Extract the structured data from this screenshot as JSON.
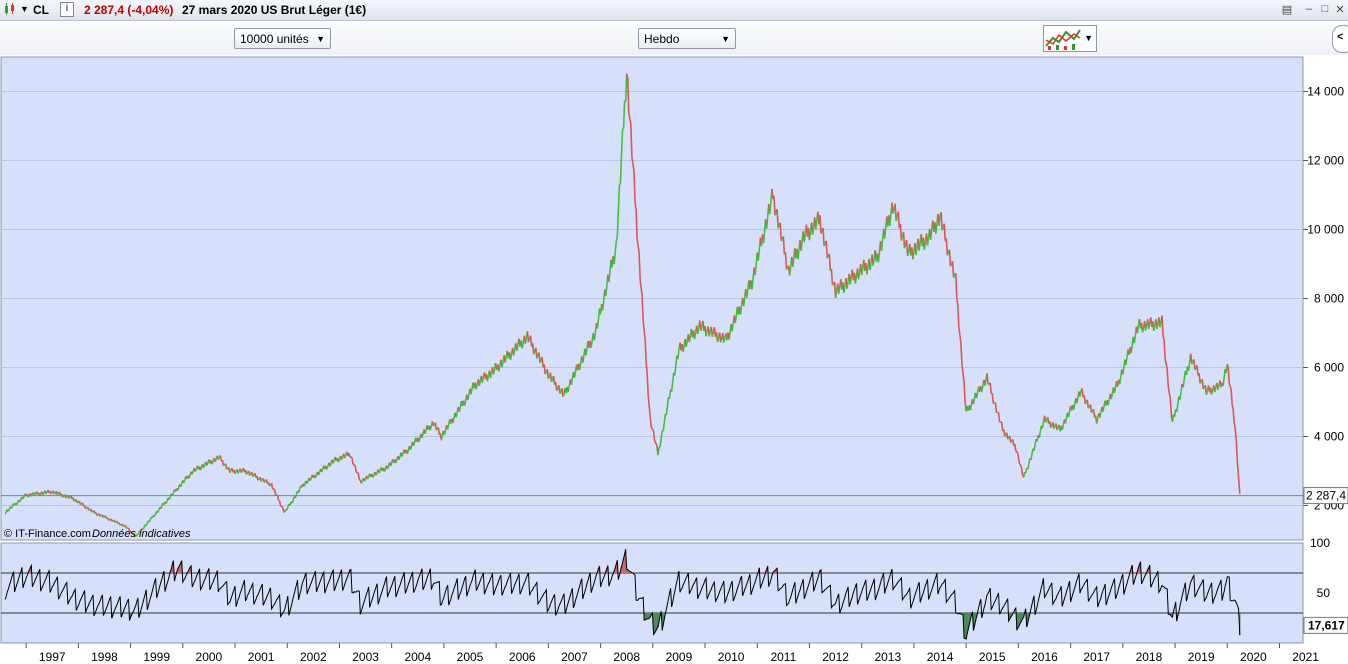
{
  "header": {
    "symbol": "CL",
    "info_icon": "i",
    "quote": "2 287,4 (-4,04%)",
    "date_name": "27 mars 2020 US Brut Léger (1€)"
  },
  "toolbar": {
    "units_select": "10000 unités",
    "period_select": "Hebdo"
  },
  "icons": [
    "candlestick-icon",
    "dropdown-arrow-icon",
    "info-icon",
    "chart-type-icon",
    "minimize-icon",
    "restore-icon",
    "close-icon",
    "nav-arrow-icon"
  ],
  "colors": {
    "background": "#d7e0fb",
    "up": "#3ec23e",
    "down": "#e05454",
    "price_line": "#3cb43c",
    "rsi_line": "#000000",
    "header_quote": "#c00000"
  },
  "credits": {
    "source": "© IT-Finance.com",
    "note": "Données indicatives"
  },
  "chart_data": [
    {
      "type": "line",
      "title": "US Brut Léger (1€)",
      "frequency": "Hebdo",
      "x_ticks": [
        "1997",
        "1998",
        "1999",
        "2000",
        "2001",
        "2002",
        "2003",
        "2004",
        "2005",
        "2006",
        "2007",
        "2008",
        "2009",
        "2010",
        "2011",
        "2012",
        "2013",
        "2014",
        "2015",
        "2016",
        "2017",
        "2018",
        "2019",
        "2020",
        "2021"
      ],
      "y_ticks": [
        "2 000",
        "4 000",
        "6 000",
        "8 000",
        "10 000",
        "12 000",
        "14 000"
      ],
      "ylim": [
        1000,
        15000
      ],
      "grid": true,
      "current_value_label": "2 287,4",
      "current_value": 2287.4,
      "series": [
        {
          "x": [
            1996.6,
            1997.0,
            1997.5,
            1997.9,
            1998.3,
            1998.9,
            1999.1,
            1999.5,
            1999.9,
            2000.2,
            2000.7,
            2000.9,
            2001.2,
            2001.7,
            2001.95,
            2002.3,
            2002.9,
            2003.2,
            2003.4,
            2003.9,
            2004.3,
            2004.8,
            2004.95,
            2005.6,
            2005.95,
            2006.6,
            2007.0,
            2007.3,
            2007.9,
            2008.3,
            2008.5,
            2008.7,
            2008.95,
            2009.1,
            2009.5,
            2009.9,
            2010.4,
            2010.9,
            2011.3,
            2011.6,
            2011.9,
            2012.2,
            2012.5,
            2012.9,
            2013.3,
            2013.6,
            2013.9,
            2014.3,
            2014.5,
            2014.8,
            2015.0,
            2015.4,
            2015.7,
            2015.95,
            2016.1,
            2016.5,
            2016.8,
            2017.2,
            2017.5,
            2017.9,
            2018.3,
            2018.75,
            2018.95,
            2019.3,
            2019.6,
            2019.9,
            2020.0,
            2020.15,
            2020.24
          ],
          "y": [
            1800,
            2300,
            2400,
            2200,
            1800,
            1400,
            1100,
            1800,
            2500,
            3000,
            3400,
            3000,
            3000,
            2600,
            1800,
            2600,
            3300,
            3500,
            2700,
            3100,
            3600,
            4400,
            4000,
            5500,
            5900,
            6900,
            5800,
            5200,
            7000,
            9500,
            14600,
            10000,
            4500,
            3500,
            6500,
            7200,
            6800,
            8500,
            11000,
            8800,
            9800,
            10300,
            8200,
            8700,
            9200,
            10700,
            9300,
            9800,
            10400,
            8500,
            4700,
            5700,
            4200,
            3700,
            2800,
            4500,
            4200,
            5300,
            4500,
            5500,
            7200,
            7300,
            4400,
            6300,
            5300,
            5500,
            6100,
            4300,
            2287
          ]
        }
      ]
    },
    {
      "type": "line",
      "x_ticks": [
        "1997",
        "1998",
        "1999",
        "2000",
        "2001",
        "2002",
        "2003",
        "2004",
        "2005",
        "2006",
        "2007",
        "2008",
        "2009",
        "2010",
        "2011",
        "2012",
        "2013",
        "2014",
        "2015",
        "2016",
        "2017",
        "2018",
        "2019",
        "2020",
        "2021"
      ],
      "y_ticks": [
        "100",
        "50"
      ],
      "ylim": [
        0,
        100
      ],
      "bands": [
        30,
        70
      ],
      "current_value_label": "17,617",
      "current_value": 17.617,
      "series": [
        {
          "x": [
            1996.6,
            1997.0,
            1997.5,
            1997.9,
            1998.3,
            1998.9,
            1999.1,
            1999.5,
            1999.9,
            2000.2,
            2000.7,
            2000.9,
            2001.2,
            2001.7,
            2001.95,
            2002.3,
            2002.9,
            2003.2,
            2003.4,
            2003.9,
            2004.3,
            2004.8,
            2004.95,
            2005.6,
            2005.95,
            2006.6,
            2007.0,
            2007.3,
            2007.9,
            2008.3,
            2008.5,
            2008.7,
            2008.95,
            2009.1,
            2009.5,
            2009.9,
            2010.4,
            2010.9,
            2011.3,
            2011.6,
            2011.9,
            2012.2,
            2012.5,
            2012.9,
            2013.3,
            2013.6,
            2013.9,
            2014.3,
            2014.5,
            2014.8,
            2015.0,
            2015.4,
            2015.7,
            2015.95,
            2016.1,
            2016.5,
            2016.8,
            2017.2,
            2017.5,
            2017.9,
            2018.3,
            2018.75,
            2018.95,
            2019.3,
            2019.6,
            2019.9,
            2020.0,
            2020.15,
            2020.24
          ],
          "y": [
            55,
            68,
            60,
            45,
            38,
            35,
            32,
            55,
            75,
            65,
            62,
            45,
            52,
            45,
            32,
            60,
            62,
            65,
            40,
            55,
            60,
            65,
            45,
            62,
            58,
            60,
            40,
            38,
            65,
            70,
            85,
            50,
            20,
            15,
            62,
            55,
            50,
            60,
            70,
            45,
            55,
            65,
            38,
            50,
            55,
            65,
            45,
            55,
            60,
            40,
            10,
            45,
            38,
            25,
            20,
            55,
            45,
            60,
            45,
            55,
            72,
            60,
            25,
            60,
            50,
            52,
            62,
            40,
            17.617
          ]
        }
      ]
    }
  ]
}
